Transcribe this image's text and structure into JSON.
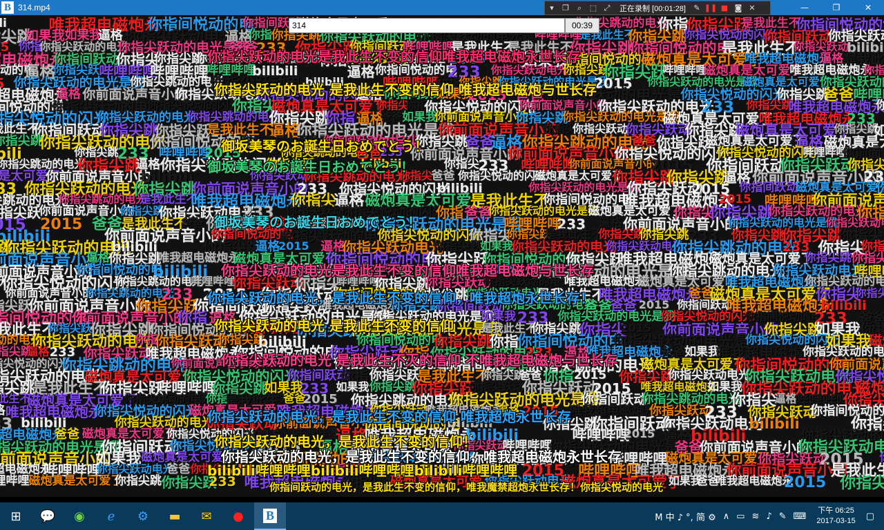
{
  "window": {
    "title": "314.mp4",
    "logo_letter": "B",
    "minimize": "—",
    "maximize": "❐",
    "close": "✕"
  },
  "recorder": {
    "status": "正在录制 [00:01:28]"
  },
  "player": {
    "search_value": "314",
    "time": "00:39"
  },
  "subtitle": "你指间跃动的电光，是我此生不变的信仰，唯我魔禁超炮永世长存！你指尖悦动的电光",
  "danmaku_center": [
    {
      "text": "你指尖跃动的电光是我此生不变的信仰唯我超电磁炮永世长存",
      "color": "#ff2d6f"
    },
    {
      "text": "你指尖跃动的电光 是我此生不变的信仰 唯我超电磁炮与世长存",
      "color": "#ffe200"
    },
    {
      "text": "御坂美琴のお誕生日おめでとう！",
      "color": "#ffe200"
    },
    {
      "text": "御坂美琴のお誕生日おめでとう！",
      "color": "#39d47a"
    },
    {
      "text": "御坂美琴のお誕生日おめでとう！",
      "color": "#3ad7e6"
    },
    {
      "text": "你指尖跃动的电光是我此生不变的信仰唯我超电磁炮与世长存",
      "color": "#ff3c8c"
    },
    {
      "text": "你指尖跃动的电光，是我此生不变的信仰，唯我超炮永世长存！",
      "color": "#2aa6ff"
    },
    {
      "text": "你指尖跃动的电光 是我此生不变的信仰",
      "color": "#ffe200"
    },
    {
      "text": "你指尖跃动的电光 是我此生不灭的信仰 不唯我超电磁炮与世长存",
      "color": "#ff3c8c"
    },
    {
      "text": "你指尖跃动的电光，是我此生不变的信仰 唯我超炮永世长存",
      "color": "#2aa6ff"
    },
    {
      "text": "你指尖跃动的电光，是我此生不变的信仰！",
      "color": "#ffe200"
    },
    {
      "text": "你指尖跃动的电光，是我此生不变的信仰，唯我超电磁炮永世长存",
      "color": "#ffffff"
    },
    {
      "text": "bilibili哔哩哔哩bilibili哔哩哔哩bilibili哔哩哔哩",
      "color": "#ffe200"
    }
  ],
  "danmaku_bg": [
    "你指尖跃动的电光",
    "你指间跃动",
    "你指尖跃动的电光是我",
    "磁炮真是太可爱了",
    "你指尖跳",
    "你指尖悦动的闪光",
    "你前面说声音小的",
    "你指",
    "你指尖跃",
    "你指间悦动的电",
    "如果我",
    "2015",
    "唯我超电磁炮永",
    "bilibili",
    "哔哩哔哩",
    "你指尖",
    "你指尖跳",
    "逼格",
    "爸爸",
    "你指尖跃动",
    "你指尖跃动电光",
    "是我此生不",
    "233",
    "你指尖跳动的电光"
  ],
  "bg_colors": [
    "#ff2020",
    "#ffffff",
    "#ffe200",
    "#2aa6ff",
    "#39d47a",
    "#ff3c8c",
    "#ffffff",
    "#c8c8c8",
    "#ff8a00",
    "#8a4bff",
    "#ffffff",
    "#1a1a1a"
  ],
  "taskbar": {
    "ime": "M 中 ♪ °, 简 ⚙",
    "clock_time": "下午 06:25",
    "clock_date": "2017-03-15"
  }
}
